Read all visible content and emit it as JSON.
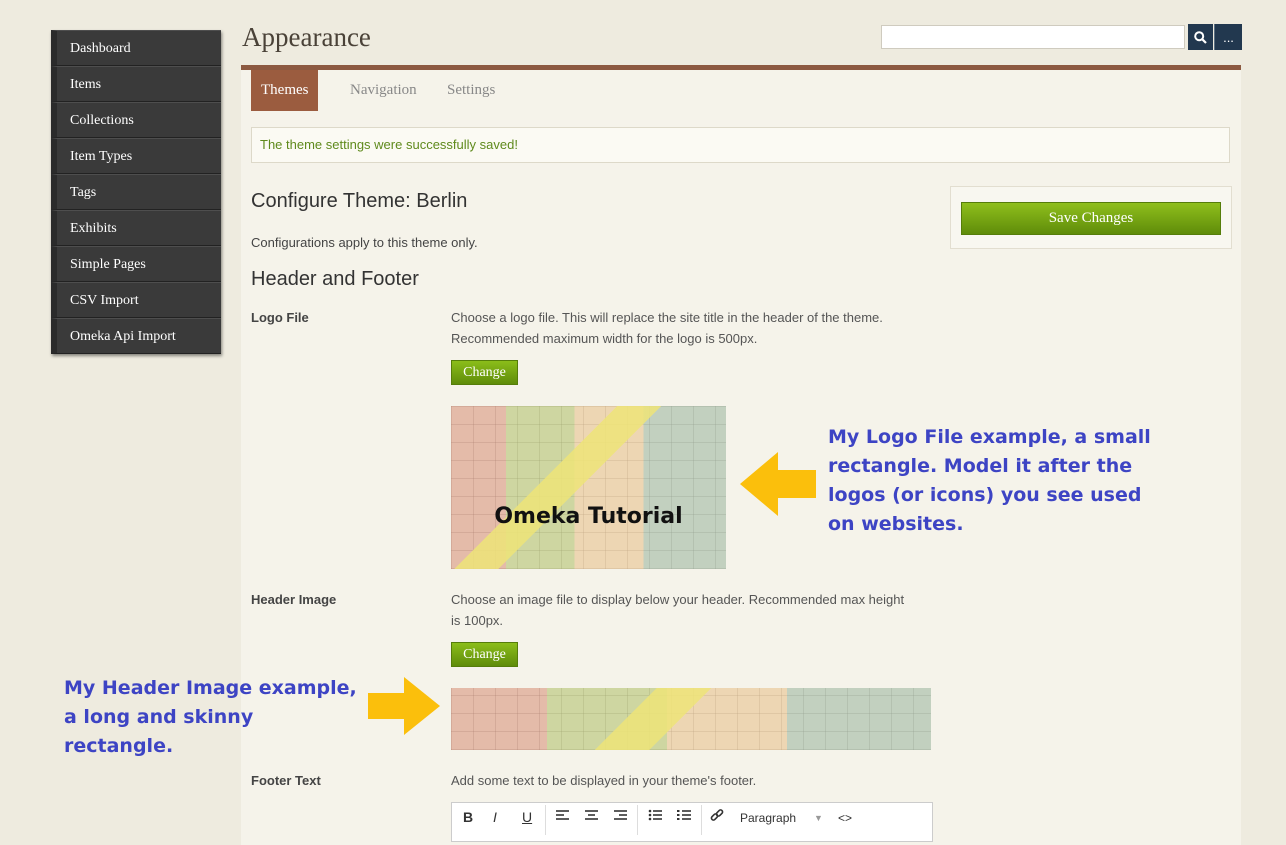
{
  "sidebar": {
    "items": [
      {
        "label": "Dashboard"
      },
      {
        "label": "Items"
      },
      {
        "label": "Collections"
      },
      {
        "label": "Item Types"
      },
      {
        "label": "Tags"
      },
      {
        "label": "Exhibits"
      },
      {
        "label": "Simple Pages"
      },
      {
        "label": "CSV Import"
      },
      {
        "label": "Omeka Api Import"
      }
    ]
  },
  "header": {
    "title": "Appearance",
    "search_button_icon": "search-icon",
    "more_button_label": "..."
  },
  "tabs": [
    {
      "label": "Themes",
      "active": true
    },
    {
      "label": "Navigation",
      "active": false
    },
    {
      "label": "Settings",
      "active": false
    }
  ],
  "flash": {
    "message": "The theme settings were successfully saved!"
  },
  "form": {
    "title": "Configure Theme: Berlin",
    "description": "Configurations apply to this theme only.",
    "section_title": "Header and Footer",
    "save_label": "Save Changes",
    "logo": {
      "label": "Logo File",
      "help": "Choose a logo file. This will replace the site title in the header of the theme. Recommended maximum width for the logo is 500px.",
      "change_label": "Change",
      "image_caption": "Omeka Tutorial"
    },
    "header_image": {
      "label": "Header Image",
      "help": "Choose an image file to display below your header. Recommended max height is 100px.",
      "change_label": "Change"
    },
    "footer": {
      "label": "Footer Text",
      "help": "Add some text to be displayed in your theme's footer.",
      "toolbar": {
        "bold": "B",
        "italic": "I",
        "underline": "U",
        "format_select": "Paragraph",
        "code": "<>"
      }
    }
  },
  "annotations": {
    "logo_note": "My Logo File example, a small rectangle. Model it after the logos (or icons) you see used on websites.",
    "header_note": "My Header Image example, a long and skinny rectangle."
  },
  "colors": {
    "accent": "#9b5c3f",
    "save_green": "#6a9a0e",
    "annotation_blue": "#3d44c4",
    "arrow_yellow": "#fbbf0c",
    "sidebar_bg": "#3a3a3a"
  }
}
